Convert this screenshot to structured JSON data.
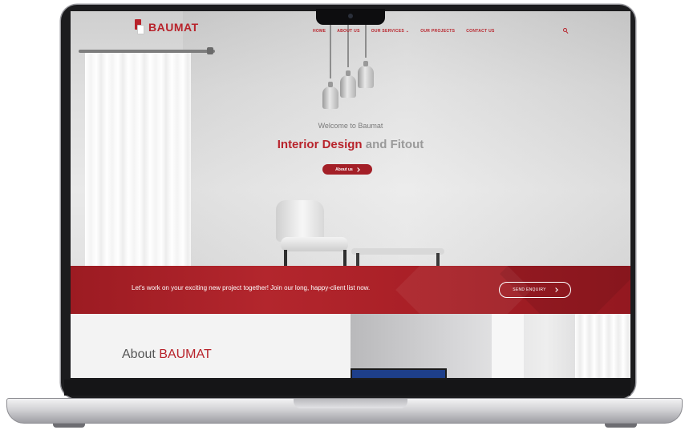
{
  "site": {
    "logo_text": "BAUMAT",
    "nav": [
      {
        "label": "HOME"
      },
      {
        "label": "ABOUT US"
      },
      {
        "label": "OUR SERVICES ⌄"
      },
      {
        "label": "OUR PROJECTS"
      },
      {
        "label": "CONTACT US"
      }
    ],
    "search_icon": "search-icon"
  },
  "hero": {
    "welcome": "Welcome to Baumat",
    "headline_accent": "Interior Design",
    "headline_rest": "and Fitout",
    "button_label": "About us"
  },
  "cta_band": {
    "text": "Let's work on your exciting new project together! Join our long, happy-client list now.",
    "button_label": "SEND ENQUIRY"
  },
  "about": {
    "title_prefix": "About",
    "title_accent": "BAUMAT"
  },
  "colors": {
    "brand_red": "#b8232b",
    "laptop_bezel": "#1c1c1e"
  }
}
